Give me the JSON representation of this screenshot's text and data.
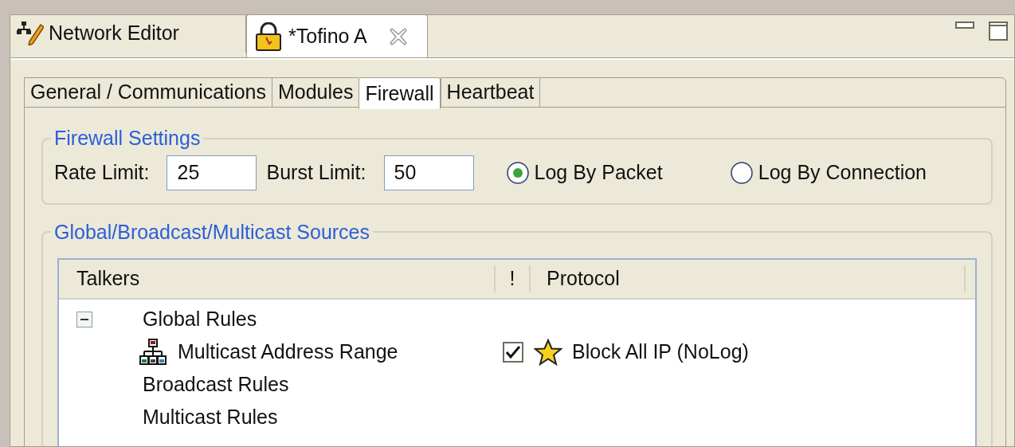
{
  "editor_tabs": [
    {
      "label": "Network Editor",
      "selected": false
    },
    {
      "label": "*Tofino A",
      "selected": true
    }
  ],
  "page_tabs": [
    {
      "label": "General / Communications",
      "selected": false
    },
    {
      "label": "Modules",
      "selected": false
    },
    {
      "label": "Firewall",
      "selected": true
    },
    {
      "label": "Heartbeat",
      "selected": false
    }
  ],
  "firewall_settings": {
    "title": "Firewall Settings",
    "rate_limit": {
      "label": "Rate Limit:",
      "value": "25"
    },
    "burst_limit": {
      "label": "Burst Limit:",
      "value": "50"
    },
    "logging": [
      {
        "label": "Log By Packet",
        "selected": true
      },
      {
        "label": "Log By Connection",
        "selected": false
      }
    ]
  },
  "sources": {
    "title": "Global/Broadcast/Multicast Sources",
    "columns": [
      "Talkers",
      "!",
      "Protocol"
    ],
    "tree": [
      {
        "label": "Global Rules",
        "expanded": true,
        "children": [
          {
            "label": "Multicast Address Range",
            "checked": true,
            "protocol": "Block All IP (NoLog)"
          }
        ]
      },
      {
        "label": "Broadcast Rules"
      },
      {
        "label": "Multicast Rules"
      }
    ]
  }
}
